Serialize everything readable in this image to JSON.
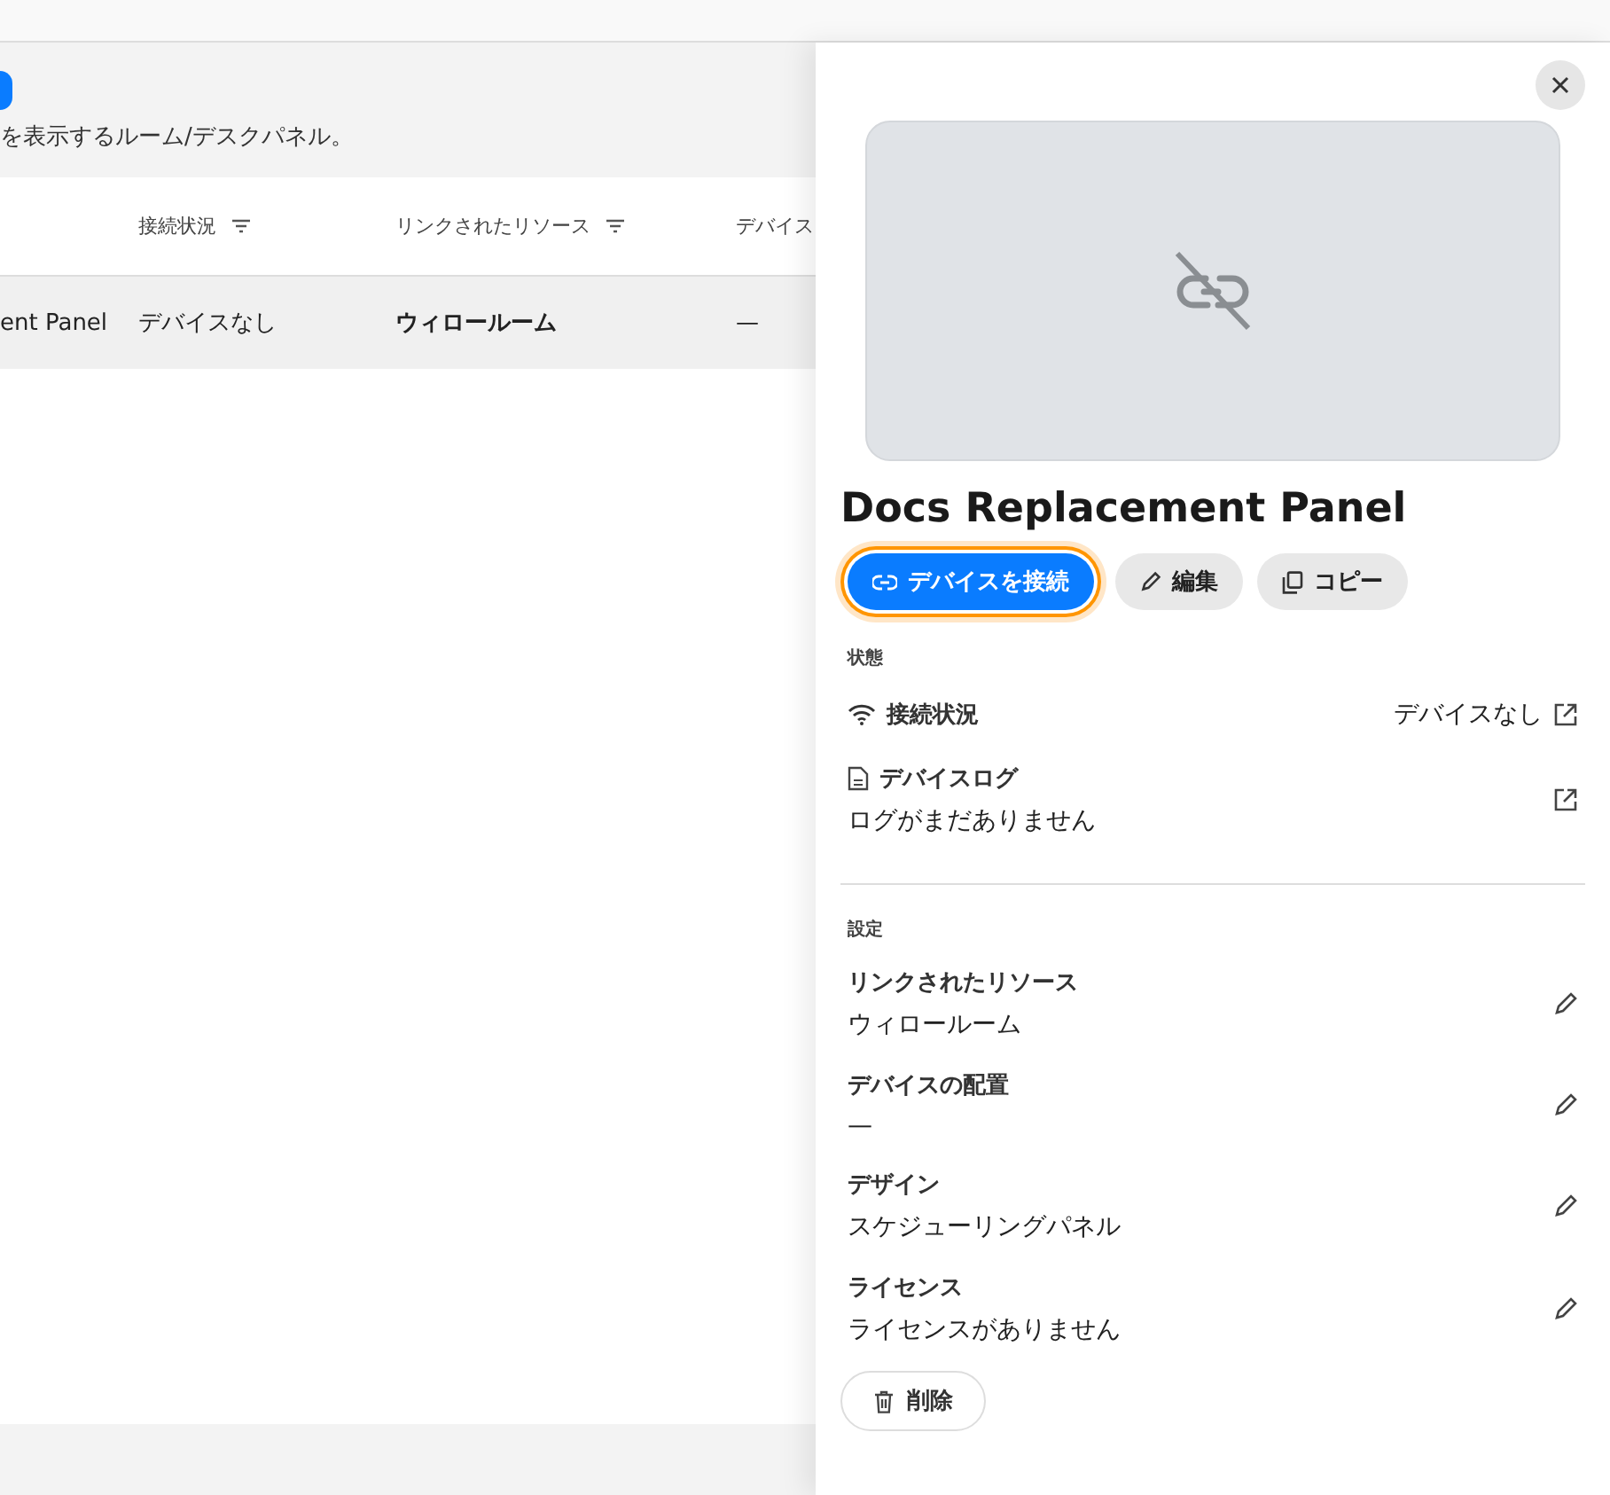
{
  "page": {
    "description": "を表示するルーム/デスクパネル。"
  },
  "table": {
    "columns": [
      {},
      {
        "label": "接続状況",
        "filter": true
      },
      {
        "label": "リンクされたリソース",
        "filter": true
      },
      {
        "label": "デバイス",
        "filter": false
      }
    ],
    "rows": [
      {
        "selected": true,
        "cells": [
          "ent Panel",
          "デバイスなし",
          "ウィロールーム",
          "—"
        ]
      }
    ]
  },
  "panel": {
    "title": "Docs Replacement Panel",
    "actions": [
      {
        "kind": "link",
        "label": "デバイスを接続",
        "primary": true,
        "focused": true
      },
      {
        "kind": "edit",
        "label": "編集",
        "primary": false,
        "focused": false
      },
      {
        "kind": "copy",
        "label": "コピー",
        "primary": false,
        "focused": false
      }
    ],
    "status_heading": "状態",
    "status": [
      {
        "kind": "wifi",
        "label": "接続状況",
        "value": "デバイスなし"
      },
      {
        "kind": "doc",
        "label": "デバイスログ",
        "note": "ログがまだありません"
      }
    ],
    "settings_heading": "設定",
    "settings": [
      {
        "label": "リンクされたリソース",
        "value": "ウィロールーム"
      },
      {
        "label": "デバイスの配置",
        "value": "—"
      },
      {
        "label": "デザイン",
        "value": "スケジューリングパネル"
      },
      {
        "label": "ライセンス",
        "value": "ライセンスがありません"
      }
    ],
    "delete_label": "削除"
  }
}
